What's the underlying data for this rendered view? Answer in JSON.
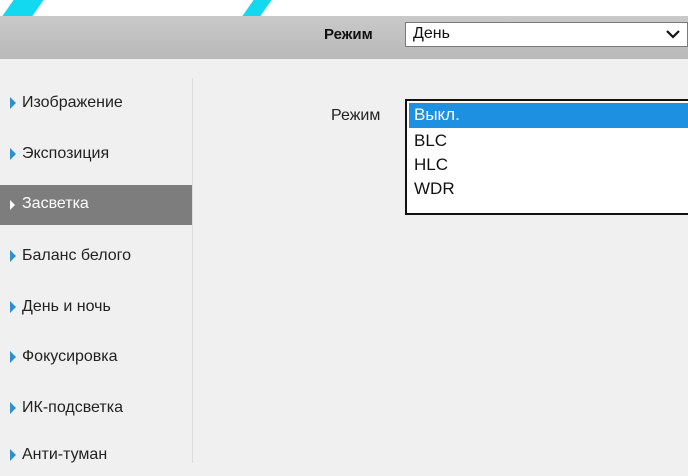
{
  "header": {
    "mode_label": "Режим",
    "mode_value": "День"
  },
  "sidebar": {
    "items": [
      {
        "label": "Изображение",
        "active": false
      },
      {
        "label": "Экспозиция",
        "active": false
      },
      {
        "label": "Засветка",
        "active": true
      },
      {
        "label": "Баланс белого",
        "active": false
      },
      {
        "label": "День и ночь",
        "active": false
      },
      {
        "label": "Фокусировка",
        "active": false
      },
      {
        "label": "ИК-подсветка",
        "active": false
      },
      {
        "label": "Анти-туман",
        "active": false
      }
    ]
  },
  "main": {
    "mode_label": "Режим",
    "dropdown": {
      "options": [
        "Выкл.",
        "BLC",
        "HLC",
        "WDR"
      ],
      "selected": "Выкл."
    }
  },
  "colors": {
    "accent": "#1e90e2",
    "active_nav": "#7d7d7d",
    "header_bar": "#bfbfbf",
    "decoration": "#12d8f0"
  },
  "icons": {
    "nav_arrow": "caret-right-icon",
    "select_arrow": "chevron-down-icon"
  }
}
